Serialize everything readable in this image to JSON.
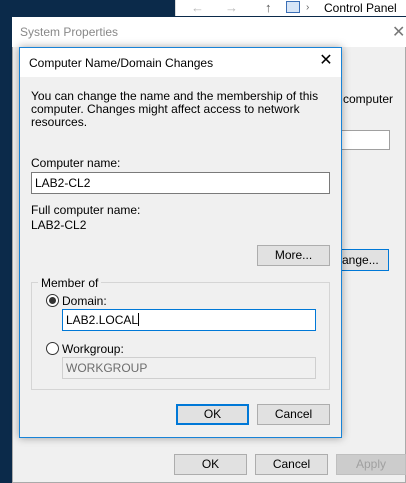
{
  "explorer": {
    "back_icon": "←",
    "forward_icon": "→",
    "up_icon": "↑",
    "separator_icon": "›",
    "breadcrumb": "Control Panel"
  },
  "system_properties": {
    "title": "System Properties",
    "close_icon": "✕",
    "side_text": "computer",
    "change_button_label": "ange...",
    "ok_label": "OK",
    "cancel_label": "Cancel",
    "apply_label": "Apply"
  },
  "dialog": {
    "title": "Computer Name/Domain Changes",
    "close_icon": "✕",
    "description": "You can change the name and the membership of this computer. Changes might affect access to network resources.",
    "computer_name_label": "Computer name:",
    "computer_name_value": "LAB2-CL2",
    "full_name_label": "Full computer name:",
    "full_name_value": "LAB2-CL2",
    "more_button_label": "More...",
    "member_of_label": "Member of",
    "domain_label": "Domain:",
    "domain_value": "LAB2.LOCAL",
    "domain_selected": true,
    "workgroup_label": "Workgroup:",
    "workgroup_value": "WORKGROUP",
    "ok_label": "OK",
    "cancel_label": "Cancel"
  }
}
